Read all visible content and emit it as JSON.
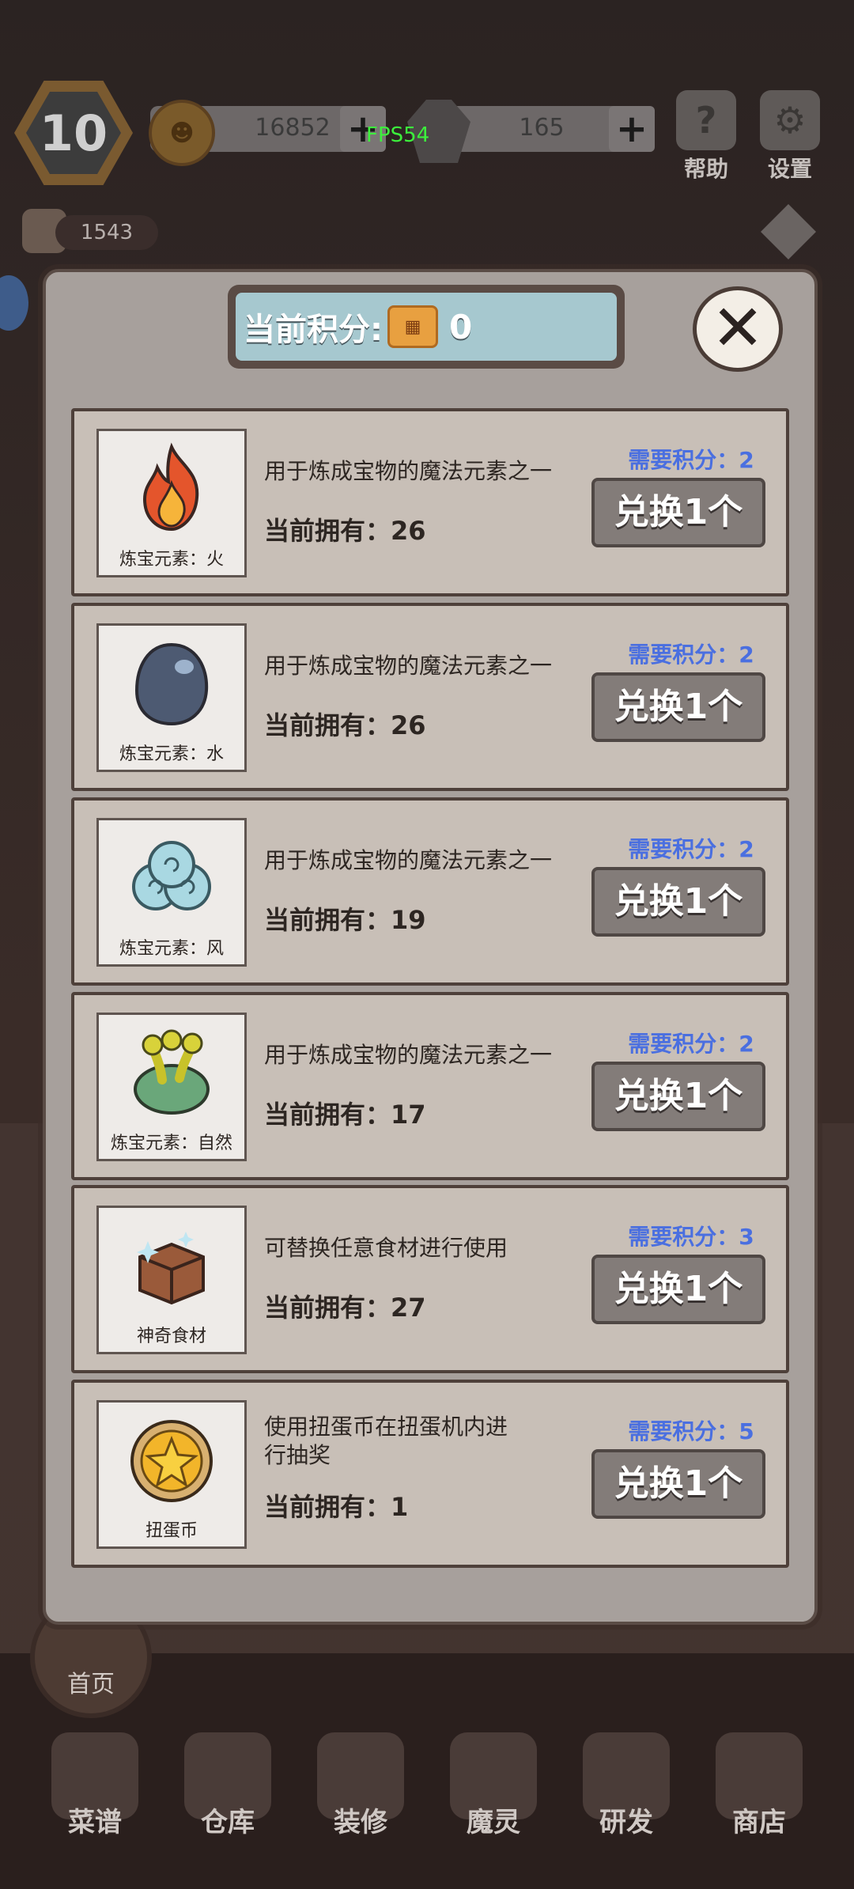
{
  "hud": {
    "level": "10",
    "coins": "16852",
    "gems": "165",
    "fps": "FPS54",
    "help_label": "帮助",
    "settings_label": "设置",
    "side_count": "1543"
  },
  "modal": {
    "score_label": "当前积分:",
    "score_value": "0",
    "close_symbol": "✕",
    "items": [
      {
        "name": "炼宝元素：火",
        "desc": "用于炼成宝物的魔法元素之一",
        "owned": "当前拥有：26",
        "cost": "需要积分：2",
        "button": "兑换1个",
        "icon": "fire-element-icon"
      },
      {
        "name": "炼宝元素：水",
        "desc": "用于炼成宝物的魔法元素之一",
        "owned": "当前拥有：26",
        "cost": "需要积分：2",
        "button": "兑换1个",
        "icon": "water-element-icon"
      },
      {
        "name": "炼宝元素：风",
        "desc": "用于炼成宝物的魔法元素之一",
        "owned": "当前拥有：19",
        "cost": "需要积分：2",
        "button": "兑换1个",
        "icon": "wind-element-icon"
      },
      {
        "name": "炼宝元素：自然",
        "desc": "用于炼成宝物的魔法元素之一",
        "owned": "当前拥有：17",
        "cost": "需要积分：2",
        "button": "兑换1个",
        "icon": "nature-element-icon"
      },
      {
        "name": "神奇食材",
        "desc": "可替换任意食材进行使用",
        "owned": "当前拥有：27",
        "cost": "需要积分：3",
        "button": "兑换1个",
        "icon": "magic-ingredient-crate-icon"
      },
      {
        "name": "扭蛋币",
        "desc": "使用扭蛋币在扭蛋机内进行抽奖",
        "owned": "当前拥有：1",
        "cost": "需要积分：5",
        "button": "兑换1个",
        "icon": "gacha-coin-icon"
      }
    ]
  },
  "nav": {
    "home": "首页",
    "items": [
      "菜谱",
      "仓库",
      "装修",
      "魔灵",
      "研发",
      "商店"
    ]
  },
  "colors": {
    "cost_blue": "#4a6fe0",
    "score_panel": "#a6c8cf",
    "button_gray": "#837c79"
  }
}
